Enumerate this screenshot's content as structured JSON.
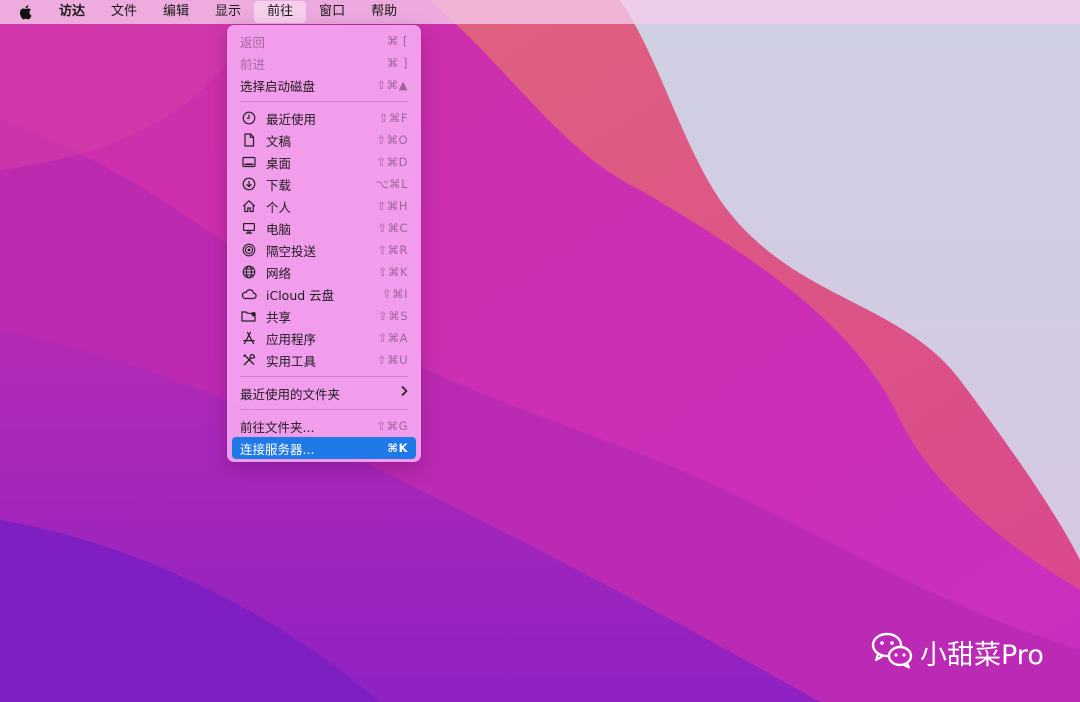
{
  "menubar": {
    "items": [
      {
        "label": "访达"
      },
      {
        "label": "文件"
      },
      {
        "label": "编辑"
      },
      {
        "label": "显示"
      },
      {
        "label": "前往"
      },
      {
        "label": "窗口"
      },
      {
        "label": "帮助"
      }
    ]
  },
  "go_menu": {
    "items": [
      {
        "label": "返回",
        "shortcut": "⌘ [",
        "icon": ""
      },
      {
        "label": "前进",
        "shortcut": "⌘ ]",
        "icon": ""
      },
      {
        "label": "选择启动磁盘",
        "shortcut": "⇧⌘▲",
        "icon": ""
      },
      {
        "label": "最近使用",
        "shortcut": "⇧⌘F",
        "icon": "clock-icon"
      },
      {
        "label": "文稿",
        "shortcut": "⇧⌘O",
        "icon": "document-icon"
      },
      {
        "label": "桌面",
        "shortcut": "⇧⌘D",
        "icon": "desktop-icon"
      },
      {
        "label": "下载",
        "shortcut": "⌥⌘L",
        "icon": "download-icon"
      },
      {
        "label": "个人",
        "shortcut": "⇧⌘H",
        "icon": "home-icon"
      },
      {
        "label": "电脑",
        "shortcut": "⇧⌘C",
        "icon": "computer-icon"
      },
      {
        "label": "隔空投送",
        "shortcut": "⇧⌘R",
        "icon": "airdrop-icon"
      },
      {
        "label": "网络",
        "shortcut": "⇧⌘K",
        "icon": "network-icon"
      },
      {
        "label": "iCloud 云盘",
        "shortcut": "⇧⌘I",
        "icon": "cloud-icon"
      },
      {
        "label": "共享",
        "shortcut": "⇧⌘S",
        "icon": "shared-folder-icon"
      },
      {
        "label": "应用程序",
        "shortcut": "⇧⌘A",
        "icon": "applications-icon"
      },
      {
        "label": "实用工具",
        "shortcut": "⇧⌘U",
        "icon": "utilities-icon"
      },
      {
        "label": "最近使用的文件夹",
        "shortcut": "",
        "icon": "chevron-right-icon"
      },
      {
        "label": "前往文件夹...",
        "shortcut": "⇧⌘G",
        "icon": ""
      },
      {
        "label": "连接服务器...",
        "shortcut": "⌘K",
        "icon": ""
      }
    ]
  },
  "watermark": {
    "text": "小甜菜Pro",
    "icon": "wechat-icon"
  },
  "colors": {
    "accent": "#1f7ae8",
    "menu_bg": "#f4a4f0",
    "wallpaper": "#c129b8"
  }
}
